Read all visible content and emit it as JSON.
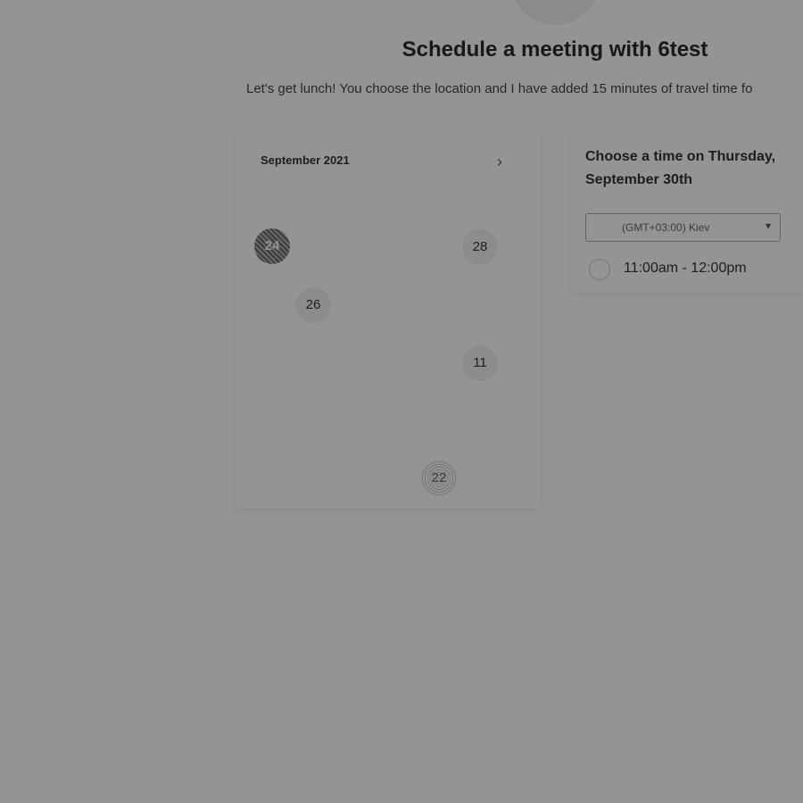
{
  "header": {
    "title": "Schedule a meeting with 6test",
    "subtitle": "Let's get lunch! You choose the location and I have added 15 minutes of travel time fo"
  },
  "calendar": {
    "month_label": "September 2021",
    "next_icon": "chevron-right-icon",
    "next_glyph": "›",
    "days": {
      "today": "24",
      "d28": "28",
      "d26": "26",
      "d11": "11",
      "d22": "22"
    }
  },
  "time_panel": {
    "heading": "Choose a time on Thursday, September 30th",
    "timezone": "(GMT+03:00) Kiev",
    "caret_glyph": "▾",
    "slots": [
      {
        "label": "11:00am - 12:00pm"
      }
    ]
  },
  "colors": {
    "overlay": "rgba(0,0,0,0.42)",
    "card": "#ffffff",
    "text": "#333333"
  }
}
